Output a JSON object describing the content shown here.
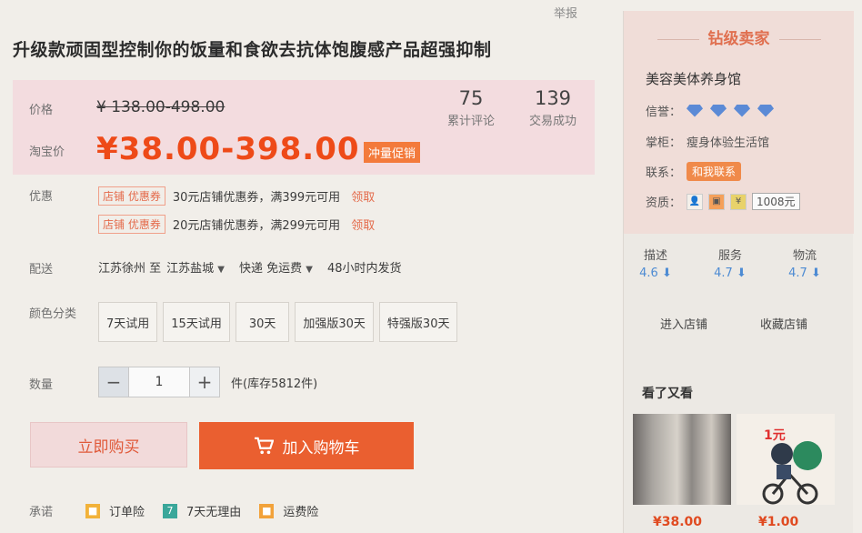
{
  "report_link": "举报",
  "title": "升级款顽固型控制你的饭量和食欲去抗体饱腹感产品超强抑制",
  "price": {
    "label": "价格",
    "original": "¥ 138.00-498.00",
    "taobao_label": "淘宝价",
    "promo": "¥38.00-398.00",
    "promo_badge": "冲量促销"
  },
  "stats": {
    "reviews_value": "75",
    "reviews_label": "累计评论",
    "deals_value": "139",
    "deals_label": "交易成功"
  },
  "coupons": {
    "label": "优惠",
    "items": [
      {
        "tag": "店铺 优惠券",
        "text": "30元店铺优惠券，满399元可用",
        "link": "领取"
      },
      {
        "tag": "店铺 优惠券",
        "text": "20元店铺优惠券，满299元可用",
        "link": "领取"
      }
    ]
  },
  "delivery": {
    "label": "配送",
    "from": "江苏徐州 至",
    "to": "江苏盐城",
    "method": "快递 免运费",
    "ship_time": "48小时内发货"
  },
  "color_options": {
    "label": "颜色分类",
    "items": [
      "7天试用",
      "15天试用",
      "30天",
      "加强版30天",
      "特强版30天"
    ]
  },
  "quantity": {
    "label": "数量",
    "minus": "−",
    "value": "1",
    "plus": "+",
    "stock": "件(库存5812件)"
  },
  "buttons": {
    "buy_now": "立即购买",
    "add_to_cart": "加入购物车"
  },
  "promise": {
    "label": "承诺",
    "items": [
      "订单险",
      "7天无理由",
      "运费险"
    ]
  },
  "seller": {
    "rank": "钻级卖家",
    "shop_name": "美容美体养身馆",
    "credit_label": "信誉：",
    "credit_diamonds": 4,
    "keeper_label": "掌柜：",
    "keeper": "瘦身体验生活馆",
    "contact_label": "联系：",
    "contact_button": "和我联系",
    "qual_label": "资质：",
    "bail": "1008元",
    "ratings": [
      {
        "name": "描述",
        "value": "4.6"
      },
      {
        "name": "服务",
        "value": "4.7"
      },
      {
        "name": "物流",
        "value": "4.7"
      }
    ],
    "enter_shop": "进入店铺",
    "favorite_shop": "收藏店铺",
    "also_viewed": "看了又看",
    "rec_prices": [
      "¥38.00",
      "¥1.00"
    ]
  },
  "colors": {
    "accent": "#ee4a18",
    "cart_button": "#ea5f30",
    "diamond": "#5b8ad6"
  }
}
